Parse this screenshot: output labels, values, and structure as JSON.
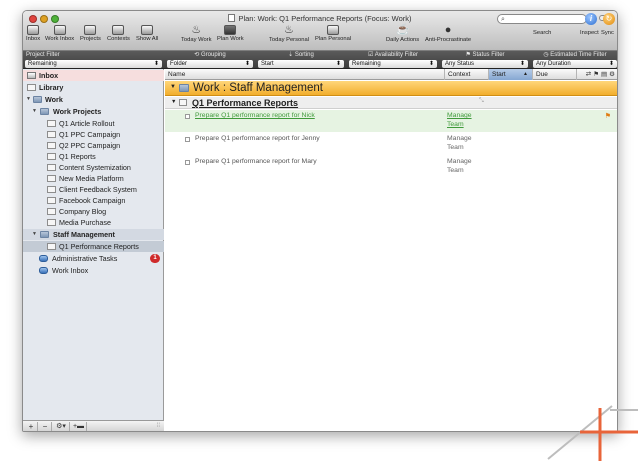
{
  "window": {
    "title": "Plan: Work: Q1 Performance Reports (Focus: Work)"
  },
  "toolbar": {
    "items": [
      {
        "label": "Inbox",
        "icon": "inbox-tray-icon"
      },
      {
        "label": "Work Inbox",
        "icon": "inbox-tray-icon"
      },
      {
        "label": "Projects",
        "icon": "projects-icon"
      },
      {
        "label": "Contexts",
        "icon": "contexts-icon"
      },
      {
        "label": "Show All",
        "icon": "show-all-icon"
      },
      {
        "label": "Today Work",
        "icon": "flame-icon"
      },
      {
        "label": "Plan Work",
        "icon": "calendar-grid-icon"
      },
      {
        "label": "Today Personal",
        "icon": "flame-icon"
      },
      {
        "label": "Plan Personal",
        "icon": "calendar-grid-icon"
      },
      {
        "label": "Daily Actions",
        "icon": "coffee-cup-icon"
      },
      {
        "label": "Anti-Procrastinate",
        "icon": "bomb-icon"
      }
    ],
    "search_label": "Search",
    "inspect_label": "Inspect",
    "sync_label": "Sync"
  },
  "filterbar": {
    "project_filter": {
      "label": "Project Filter",
      "value": "Remaining"
    },
    "grouping": {
      "label": "Grouping",
      "value": "Folder"
    },
    "sorting": {
      "label": "Sorting",
      "value": "Start"
    },
    "availability": {
      "label": "Availability Filter",
      "value": "Remaining"
    },
    "status": {
      "label": "Status Filter",
      "value": "Any Status"
    },
    "estimated": {
      "label": "Estimated Time Filter",
      "value": "Any Duration"
    }
  },
  "sidebar": {
    "inbox": "Inbox",
    "library": "Library",
    "work": "Work",
    "work_projects": "Work Projects",
    "projects": [
      "Q1 Article Rollout",
      "Q1 PPC Campaign",
      "Q2 PPC Campaign",
      "Q1 Reports",
      "Content Systemization",
      "New Media Platform",
      "Client Feedback System",
      "Facebook Campaign",
      "Company Blog",
      "Media Purchase"
    ],
    "staff_management": "Staff Management",
    "q1_performance": "Q1 Performance Reports",
    "administrative": "Administrative Tasks",
    "admin_badge": "1",
    "work_inbox": "Work Inbox"
  },
  "columns": {
    "name": "Name",
    "context": "Context",
    "start": "Start",
    "due": "Due"
  },
  "main": {
    "group_title": "Work : Staff Management",
    "project_title": "Q1 Performance Reports",
    "tasks": [
      {
        "name": "Prepare Q1 performance report for Nick",
        "context_line1": "Manage",
        "context_line2": "Team"
      },
      {
        "name": "Prepare Q1 performance report for Jenny",
        "context_line1": "Manage",
        "context_line2": "Team"
      },
      {
        "name": "Prepare Q1 performance report for Mary",
        "context_line1": "Manage",
        "context_line2": "Team"
      }
    ]
  },
  "colors": {
    "accent_orange": "#f2ae2d",
    "selected_green": "#3f9a3a",
    "badge_red": "#cf2b2b"
  }
}
